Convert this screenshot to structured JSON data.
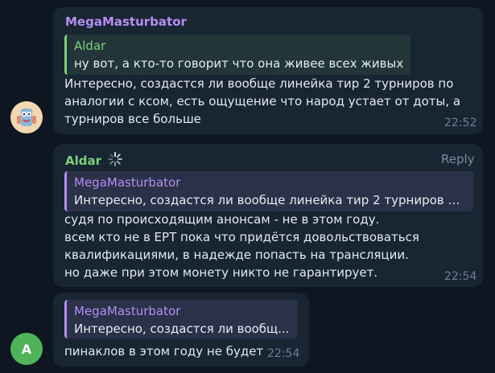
{
  "messages": [
    {
      "sender": "MegaMasturbator",
      "reply_to": {
        "name": "Aldar",
        "text": "ну вот, а кто-то говорит что она живее всех живых"
      },
      "text": "Интересно, создастся ли вообще линейка тир 2 турниров по\nаналогии с ксом, есть ощущение что народ устает от доты, а\nтурниров все больше",
      "time": "22:52",
      "avatar": "cartoon-avatar"
    },
    {
      "sender": "Aldar",
      "reply_label": "Reply",
      "reply_to": {
        "name": "MegaMasturbator",
        "text": "Интересно, создастся ли вообще линейка тир 2 турниров по..."
      },
      "text": "судя по происходящим анонсам - не в этом году.\nвсем кто не в EPT пока что придётся довольствоваться\nквалификациями, в надежде попасть на трансляции.\nно даже при этом монету никто не гарантирует.",
      "time": "22:54"
    },
    {
      "reply_to": {
        "name": "MegaMasturbator",
        "text": "Интересно, создастся ли вообщ..."
      },
      "text": "пинаклов в этом году не будет",
      "time": "22:54",
      "avatar_letter": "A"
    }
  ],
  "colors": {
    "background": "#0e1621",
    "bubble": "#182533",
    "purple": "#b48ef0",
    "green": "#7ed07a",
    "avatar_green": "#4fb35a"
  }
}
